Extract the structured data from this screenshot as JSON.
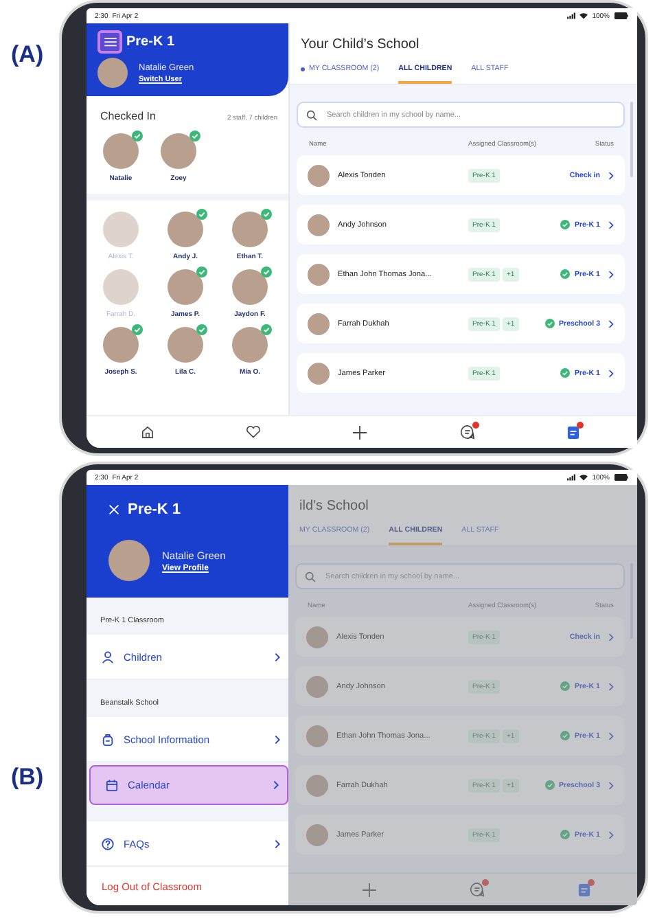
{
  "panel_a": {
    "label": "(A)",
    "status_bar": {
      "time": "2:30",
      "date": "Fri Apr 2",
      "battery": "100%"
    },
    "sidebar": {
      "menu_button": {
        "highlighted": true
      },
      "title": "Pre-K 1",
      "user": {
        "name": "Natalie Green",
        "link": "Switch User"
      },
      "checked_in": {
        "title": "Checked In",
        "summary": "2 staff, 7 children",
        "staff": [
          {
            "name": "Natalie",
            "checked": true
          },
          {
            "name": "Zoey",
            "checked": true
          }
        ]
      },
      "children": [
        {
          "name": "Alexis T.",
          "checked": false
        },
        {
          "name": "Andy J.",
          "checked": true
        },
        {
          "name": "Ethan T.",
          "checked": true
        },
        {
          "name": "Farrah D.",
          "checked": false
        },
        {
          "name": "James P.",
          "checked": true
        },
        {
          "name": "Jaydon F.",
          "checked": true
        },
        {
          "name": "Joseph S.",
          "checked": true
        },
        {
          "name": "Lila C.",
          "checked": true
        },
        {
          "name": "Mia O.",
          "checked": true
        }
      ]
    },
    "main": {
      "title": "Your Child’s School",
      "tabs": [
        {
          "label": "MY CLASSROOM (2)",
          "indicator": true,
          "selected": false
        },
        {
          "label": "ALL CHILDREN",
          "indicator": false,
          "selected": true
        },
        {
          "label": "ALL STAFF",
          "indicator": false,
          "selected": false
        }
      ],
      "search": {
        "placeholder": "Search children in my school by name..."
      },
      "columns": [
        "Name",
        "Assigned Classroom(s)",
        "Status"
      ],
      "rows": [
        {
          "name": "Alexis Tonden",
          "classrooms": [
            "Pre-K 1"
          ],
          "status": {
            "kind": "check_in",
            "label": "Check in"
          }
        },
        {
          "name": "Andy Johnson",
          "classrooms": [
            "Pre-K 1"
          ],
          "status": {
            "kind": "checked_in",
            "label": "Pre-K 1"
          }
        },
        {
          "name": "Ethan John Thomas Jona...",
          "classrooms": [
            "Pre-K 1",
            "+1"
          ],
          "status": {
            "kind": "checked_in",
            "label": "Pre-K 1"
          }
        },
        {
          "name": "Farrah Dukhah",
          "classrooms": [
            "Pre-K 1",
            "+1"
          ],
          "status": {
            "kind": "checked_in",
            "label": "Preschool 3"
          }
        },
        {
          "name": "James Parker",
          "classrooms": [
            "Pre-K 1"
          ],
          "status": {
            "kind": "checked_in",
            "label": "Pre-K 1"
          }
        }
      ]
    }
  },
  "panel_b": {
    "label": "(B)",
    "status_bar": {
      "time": "2:30",
      "date": "Fri Apr 2",
      "battery": "100%"
    },
    "drawer": {
      "title": "Pre-K 1",
      "user": {
        "name": "Natalie Green",
        "link": "View Profile"
      },
      "sections": [
        {
          "title": "Pre-K 1 Classroom",
          "items": [
            {
              "label": "Children",
              "highlighted": false
            }
          ]
        },
        {
          "title": "Beanstalk School",
          "items": [
            {
              "label": "School Information",
              "highlighted": false
            },
            {
              "label": "Calendar",
              "highlighted": true
            }
          ]
        },
        {
          "items": [
            {
              "label": "FAQs",
              "highlighted": false
            }
          ]
        }
      ],
      "logout": "Log Out of Classroom"
    },
    "main": {
      "title": "ild’s School",
      "tabs": [
        {
          "label": "MY CLASSROOM (2)",
          "indicator": false,
          "selected": false
        },
        {
          "label": "ALL CHILDREN",
          "indicator": false,
          "selected": true
        },
        {
          "label": "ALL STAFF",
          "indicator": false,
          "selected": false
        }
      ],
      "search": {
        "placeholder": "Search children in my school by name..."
      },
      "columns": [
        "Name",
        "Assigned Classroom(s)",
        "Status"
      ],
      "rows": [
        {
          "name": "Alexis Tonden",
          "classrooms": [
            "Pre-K 1"
          ],
          "status": {
            "kind": "check_in",
            "label": "Check in"
          }
        },
        {
          "name": "Andy Johnson",
          "classrooms": [
            "Pre-K 1"
          ],
          "status": {
            "kind": "checked_in",
            "label": "Pre-K 1"
          }
        },
        {
          "name": "Ethan John Thomas Jona...",
          "classrooms": [
            "Pre-K 1",
            "+1"
          ],
          "status": {
            "kind": "checked_in",
            "label": "Pre-K 1"
          }
        },
        {
          "name": "Farrah Dukhah",
          "classrooms": [
            "Pre-K 1",
            "+1"
          ],
          "status": {
            "kind": "checked_in",
            "label": "Preschool 3"
          }
        },
        {
          "name": "James Parker",
          "classrooms": [
            "Pre-K 1"
          ],
          "status": {
            "kind": "checked_in",
            "label": "Pre-K 1"
          }
        }
      ]
    }
  }
}
